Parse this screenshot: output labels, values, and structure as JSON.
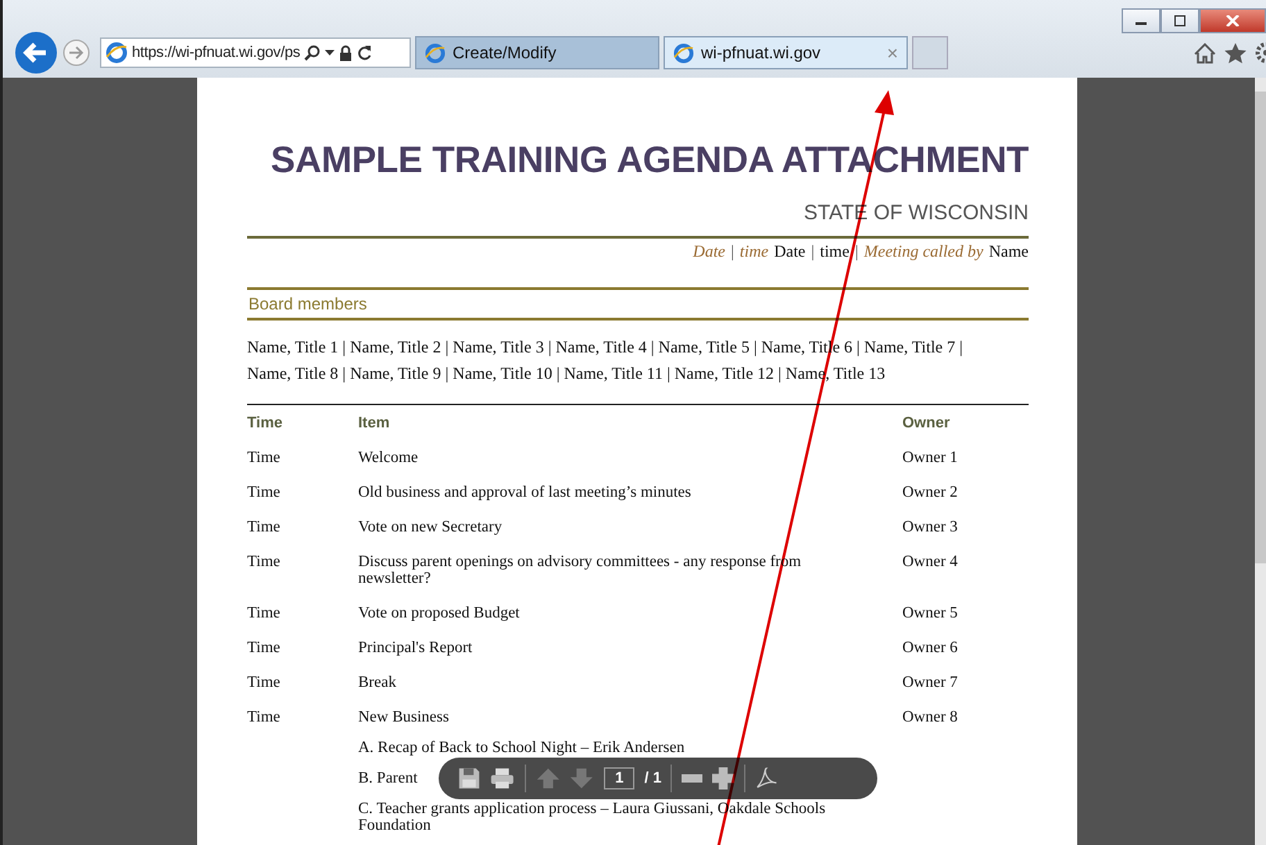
{
  "browser": {
    "address": "https://wi-pfnuat.wi.gov/ps",
    "tabs": [
      {
        "label": "Create/Modify",
        "selected": false,
        "closable": false
      },
      {
        "label": "wi-pfnuat.wi.gov",
        "selected": true,
        "closable": true
      }
    ],
    "close_glyph": "×"
  },
  "document": {
    "title": "SAMPLE TRAINING AGENDA ATTACHMENT",
    "subtitle": "STATE OF WISCONSIN",
    "meta": [
      {
        "text": "Date",
        "kind": "label"
      },
      {
        "text": "|",
        "kind": "sep"
      },
      {
        "text": "time",
        "kind": "label"
      },
      {
        "text": "Date",
        "kind": "value"
      },
      {
        "text": "|",
        "kind": "sep"
      },
      {
        "text": "time",
        "kind": "value"
      },
      {
        "text": "|",
        "kind": "sep"
      },
      {
        "text": "Meeting called by",
        "kind": "label"
      },
      {
        "text": "Name",
        "kind": "value"
      }
    ],
    "board_heading": "Board members",
    "board_members": "Name, Title 1 | Name, Title 2 | Name, Title 3 | Name, Title 4 | Name, Title 5 | Name, Title 6 | Name, Title 7 | Name, Title 8 | Name, Title 9 | Name, Title 10 | Name, Title 11 | Name, Title 12 | Name, Title 13",
    "columns": [
      "Time",
      "Item",
      "Owner"
    ],
    "rows": [
      {
        "time": "Time",
        "item": "Welcome",
        "owner": "Owner 1"
      },
      {
        "time": "Time",
        "item": "Old business and approval of last meeting’s minutes",
        "owner": "Owner 2"
      },
      {
        "time": "Time",
        "item": "Vote on new Secretary",
        "owner": "Owner 3"
      },
      {
        "time": "Time",
        "item": "Discuss parent openings on advisory committees - any response from newsletter?",
        "owner": "Owner 4"
      },
      {
        "time": "Time",
        "item": "Vote on proposed Budget",
        "owner": "Owner 5"
      },
      {
        "time": "Time",
        "item": "Principal's Report",
        "owner": "Owner 6"
      },
      {
        "time": "Time",
        "item": "Break",
        "owner": "Owner 7"
      },
      {
        "time": "Time",
        "item": "New Business",
        "owner": "Owner 8",
        "subitems": [
          "A. Recap of Back to School Night – Erik Andersen",
          "B. Parent",
          "C. Teacher grants application process – Laura Giussani, Oakdale Schools Foundation"
        ]
      }
    ]
  },
  "pdf_toolbar": {
    "page": "1",
    "total": "/ 1"
  }
}
